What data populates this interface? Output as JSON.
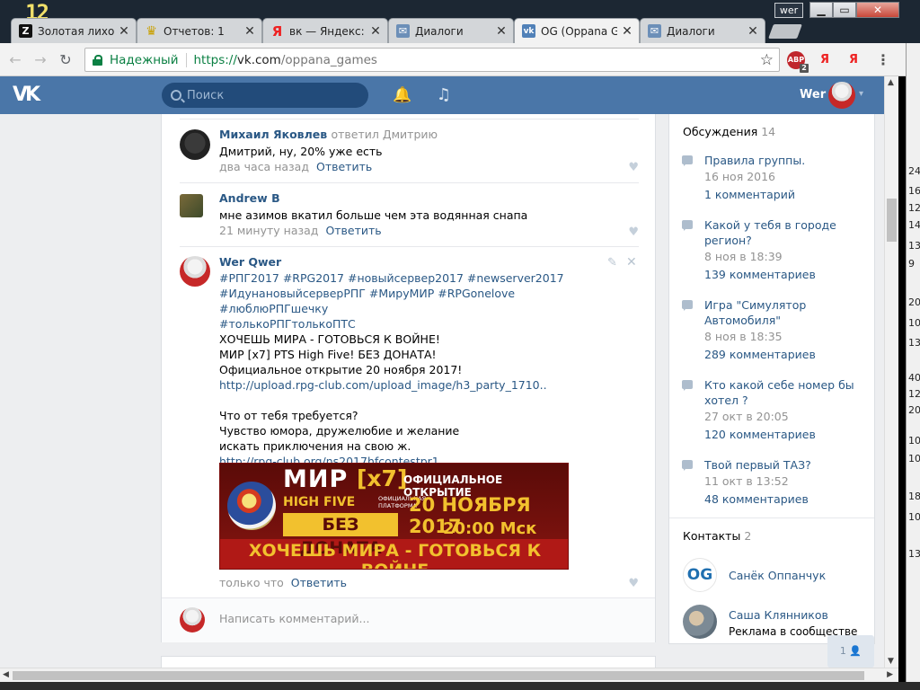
{
  "window": {
    "corner_label": "12",
    "user_chip": "wer",
    "controls": {
      "min": "▁",
      "max": "▭",
      "close": "✕"
    }
  },
  "tabs": [
    {
      "icon": "z-site-icon",
      "favicon": "Z",
      "title": "Золотая лихор",
      "close": "✕",
      "active": false
    },
    {
      "icon": "crown-icon",
      "favicon": "♛",
      "title": "Отчетов: 1",
      "close": "✕",
      "active": false
    },
    {
      "icon": "yandex-icon",
      "favicon": "Я",
      "title": "вк — Яндекс:",
      "close": "✕",
      "active": false
    },
    {
      "icon": "vk-messages-icon",
      "favicon": "✉",
      "title": "Диалоги",
      "close": "✕",
      "active": false
    },
    {
      "icon": "vk-icon",
      "favicon": "vk",
      "title": "OG (Oppana G",
      "close": "✕",
      "active": true
    },
    {
      "icon": "vk-messages-icon",
      "favicon": "✉",
      "title": "Диалоги",
      "close": "✕",
      "active": false
    }
  ],
  "toolbar": {
    "back": "←",
    "forward": "→",
    "reload": "↻",
    "secure_label": "Надежный",
    "url_scheme": "https://",
    "url_host": "vk.com",
    "url_path": "/oppana_games",
    "star": "☆",
    "ext_abp": "ABP",
    "ext_abp_badge": "2",
    "ext_y1": "Я",
    "ext_y2": "Я",
    "menu": "⋮"
  },
  "right_edge_numbers": [
    "24",
    "16",
    "12",
    "14",
    "13",
    "9",
    "20",
    "10",
    "13",
    "40",
    "12",
    "20",
    "10",
    "10",
    "18",
    "10",
    "13"
  ],
  "vk_header": {
    "logo": "VK",
    "search_placeholder": "Поиск",
    "bell": "🔔",
    "music": "♫",
    "username": "Wer",
    "chevron": "▾"
  },
  "comments": [
    {
      "author": "Михаил Яковлев",
      "reply_to": "ответил Дмитрию",
      "text": "Дмитрий, ну, 20% уже есть",
      "time": "два часа назад",
      "action": "Ответить"
    },
    {
      "author": "Andrew B",
      "reply_to": "",
      "text": "мне азимов вкатил больше чем эта водянная снапа",
      "time": "21 минуту назад",
      "action": "Ответить"
    }
  ],
  "post": {
    "author": "Wer Qwer",
    "tags_line1": "#РПГ2017 #RPG2017 #новыйсервер2017 #newserver2017",
    "tags_line2": "#ИдунановыйсерверРПГ #МируМИР #RPGonelove #люблюРПГшечку",
    "tags_line3": "#толькоРПГтолькоПТС",
    "line1": "ХОЧЕШЬ МИРА - ГОТОВЬСЯ К ВОЙНЕ!",
    "line2": "МИР [x7] PTS High Five! БЕЗ ДОНАТА!",
    "line3": "Официальное открытие 20 ноября 2017!",
    "link1": "http://upload.rpg-club.com/upload_image/h3_party_1710..",
    "q": "Что от тебя требуется?",
    "q1": "Чувство юмора, дружелюбие и желание",
    "q2": "искать приключения на свою ж.",
    "link2": "http://rpg-club.org/ns2017hfcontestpr1",
    "time": "только что",
    "action": "Ответить",
    "edit_icon": "✎",
    "close_icon": "✕",
    "banner": {
      "mir": "МИР",
      "x7": "[x7]",
      "highfive": "HIGH FIVE",
      "platform": "ОФИЦИАЛЬНАЯ ПЛАТФОРМА",
      "nodonate": "БЕЗ ДОНАТА",
      "open": "ОФИЦИАЛЬНОЕ ОТКРЫТИЕ",
      "date": "20 НОЯБРЯ 2017",
      "time": "20:00 Мск",
      "slogan": "ХОЧЕШЬ МИРА - ГОТОВЬСЯ К ВОЙНЕ"
    }
  },
  "comment_form": {
    "placeholder": "Написать комментарий..."
  },
  "heart": "♥",
  "sidebar": {
    "discussions_title": "Обсуждения",
    "discussions_count": "14",
    "discussions": [
      {
        "title": "Правила группы.",
        "date": "16 ноя 2016",
        "count": "1 комментарий"
      },
      {
        "title": "Какой у тебя в городе регион?",
        "date": "8 ноя в 18:39",
        "count": "139 комментариев"
      },
      {
        "title": "Игра \"Симулятор Автомобиля\"",
        "date": "8 ноя в 18:35",
        "count": "289 комментариев"
      },
      {
        "title": "Кто какой себе номер бы хотел ?",
        "date": "27 окт в 20:05",
        "count": "120 комментариев"
      },
      {
        "title": "Твой первый ТАЗ?",
        "date": "11 окт в 13:52",
        "count": "48 комментариев"
      }
    ],
    "contacts_title": "Контакты",
    "contacts_count": "2",
    "contacts": [
      {
        "avatar_text": "OG",
        "name": "Санёк Оппанчук",
        "sub": ""
      },
      {
        "avatar_text": "",
        "name": "Саша Клянников",
        "sub": "Реклама в сообществе"
      }
    ]
  },
  "online_chip": "1 👤",
  "scroll": {
    "up": "▲",
    "down": "▼",
    "left": "◀",
    "right": "▶"
  }
}
